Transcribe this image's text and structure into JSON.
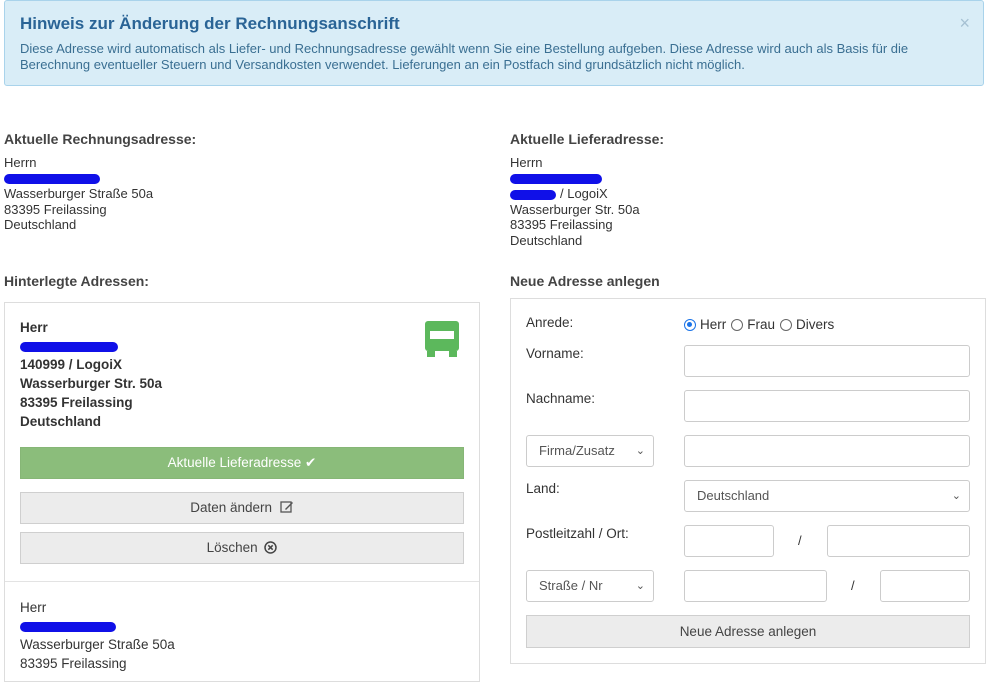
{
  "alert": {
    "title": "Hinweis zur Änderung der Rechnungsanschrift",
    "text": "Diese Adresse wird automatisch als Liefer- und Rechnungsadresse gewählt wenn Sie eine Bestellung aufgeben. Diese Adresse wird auch als Basis für die Berechnung eventueller Steuern und Versandkosten verwendet. Lieferungen an ein Postfach sind grundsätzlich nicht möglich.",
    "close": "×"
  },
  "billing": {
    "heading": "Aktuelle Rechnungsadresse:",
    "salutation": "Herrn",
    "street": "Wasserburger Straße 50a",
    "city": "83395 Freilassing",
    "country": "Deutschland"
  },
  "shipping": {
    "heading": "Aktuelle Lieferadresse:",
    "salutation": "Herrn",
    "company": "/ LogoiX",
    "street": "Wasserburger Str. 50a",
    "city": "83395 Freilassing",
    "country": "Deutschland"
  },
  "saved": {
    "heading": "Hinterlegte Adressen:",
    "card1": {
      "salutation": "Herr",
      "company": "140999 / LogoiX",
      "street": "Wasserburger Str. 50a",
      "city": "83395 Freilassing",
      "country": "Deutschland",
      "current_label": "Aktuelle Lieferadresse ✔",
      "edit_label": "Daten ändern",
      "delete_label": "Löschen",
      "icon": "truck-icon",
      "accent": "#5cb85c"
    },
    "card2": {
      "salutation": "Herr",
      "street": "Wasserburger Straße 50a",
      "city": "83395 Freilassing"
    }
  },
  "new_address": {
    "heading": "Neue Adresse anlegen",
    "anrede_label": "Anrede:",
    "anrede_options": [
      "Herr",
      "Frau",
      "Divers"
    ],
    "anrede_selected": "Herr",
    "vorname_label": "Vorname:",
    "nachname_label": "Nachname:",
    "firma_select": "Firma/Zusatz",
    "land_label": "Land:",
    "land_value": "Deutschland",
    "plz_label": "Postleitzahl / Ort:",
    "street_select": "Straße / Nr",
    "separator": "/",
    "submit_label": "Neue Adresse anlegen"
  }
}
